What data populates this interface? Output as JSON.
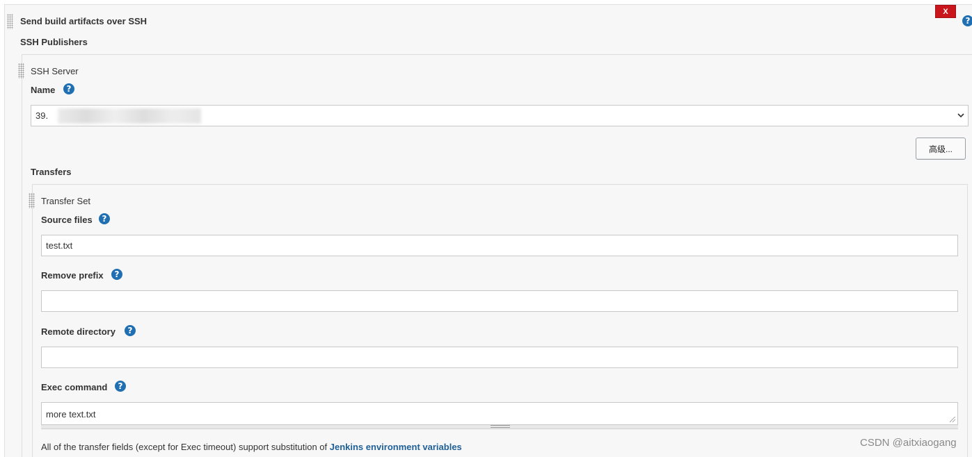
{
  "header": {
    "title": "Send build artifacts over SSH",
    "delete_label": "X",
    "help_glyph": "?"
  },
  "publishers": {
    "label": "SSH Publishers"
  },
  "ssh_server": {
    "section_label": "SSH Server",
    "name_label": "Name",
    "name_value": "39.",
    "advanced_button": "高级..."
  },
  "transfers": {
    "label": "Transfers",
    "set_label": "Transfer Set",
    "source_files": {
      "label": "Source files",
      "value": "test.txt"
    },
    "remove_prefix": {
      "label": "Remove prefix",
      "value": ""
    },
    "remote_directory": {
      "label": "Remote directory",
      "value": ""
    },
    "exec_command": {
      "label": "Exec command",
      "value": "more text.txt"
    },
    "footnote_text": "All of the transfer fields (except for Exec timeout) support substitution of ",
    "footnote_link": "Jenkins environment variables"
  },
  "watermark": "CSDN @aitxiaogang",
  "colors": {
    "delete_red": "#c9151c",
    "help_blue": "#1f6fb2",
    "link_blue": "#1f5f97",
    "panel_bg": "#f7f7f7"
  },
  "icons": {
    "help": "help-icon",
    "delete": "close-icon",
    "drag": "drag-handle-icon",
    "dropdown": "chevron-down-icon"
  }
}
